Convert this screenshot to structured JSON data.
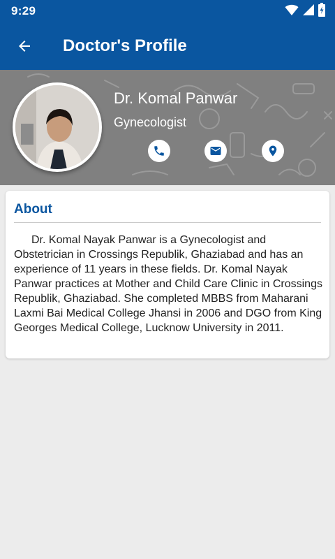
{
  "status_bar": {
    "time": "9:29",
    "icons": [
      "wifi-icon",
      "signal-icon",
      "battery-charging-icon"
    ]
  },
  "app_bar": {
    "title": "Doctor's Profile",
    "back_icon": "arrow-left-icon",
    "color": "#0a56a0"
  },
  "profile": {
    "name": "Dr. Komal Panwar",
    "specialty": "Gynecologist",
    "actions": [
      {
        "name": "call",
        "icon": "phone-icon"
      },
      {
        "name": "email",
        "icon": "mail-icon"
      },
      {
        "name": "location",
        "icon": "location-pin-icon"
      }
    ]
  },
  "about": {
    "title": "About",
    "text": "Dr. Komal Nayak Panwar is a Gynecologist and Obstetrician in Crossings Republik, Ghaziabad and has an experience of 11 years in these fields. Dr. Komal Nayak Panwar practices at Mother and Child Care Clinic in Crossings Republik, Ghaziabad. She completed MBBS from Maharani Laxmi Bai Medical College Jhansi in 2006 and DGO from King Georges Medical College, Lucknow University in 2011."
  }
}
